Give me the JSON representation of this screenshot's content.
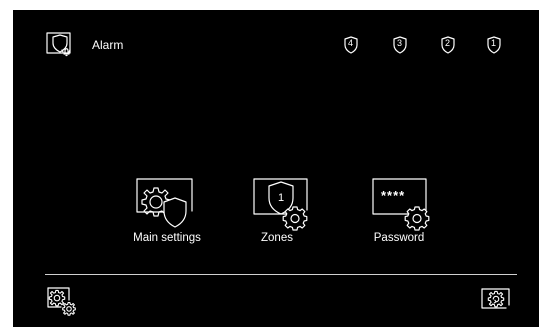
{
  "header": {
    "title": "Alarm",
    "app_icon": "alarm-shield-bell-icon",
    "zone_indicators": [
      {
        "number": "4",
        "icon": "shield-4-icon"
      },
      {
        "number": "3",
        "icon": "shield-3-icon"
      },
      {
        "number": "2",
        "icon": "shield-2-icon"
      },
      {
        "number": "1",
        "icon": "shield-1-icon"
      }
    ]
  },
  "main": {
    "tiles": [
      {
        "label": "Main settings",
        "icon": "main-settings-icon"
      },
      {
        "label": "Zones",
        "icon": "zones-icon",
        "shield_number": "1"
      },
      {
        "label": "Password",
        "icon": "password-icon",
        "masked_value": "****"
      }
    ]
  },
  "footer": {
    "left_icon": "settings-gear-icon",
    "right_icon": "refresh-settings-icon"
  },
  "colors": {
    "background": "#000000",
    "foreground": "#ffffff"
  }
}
